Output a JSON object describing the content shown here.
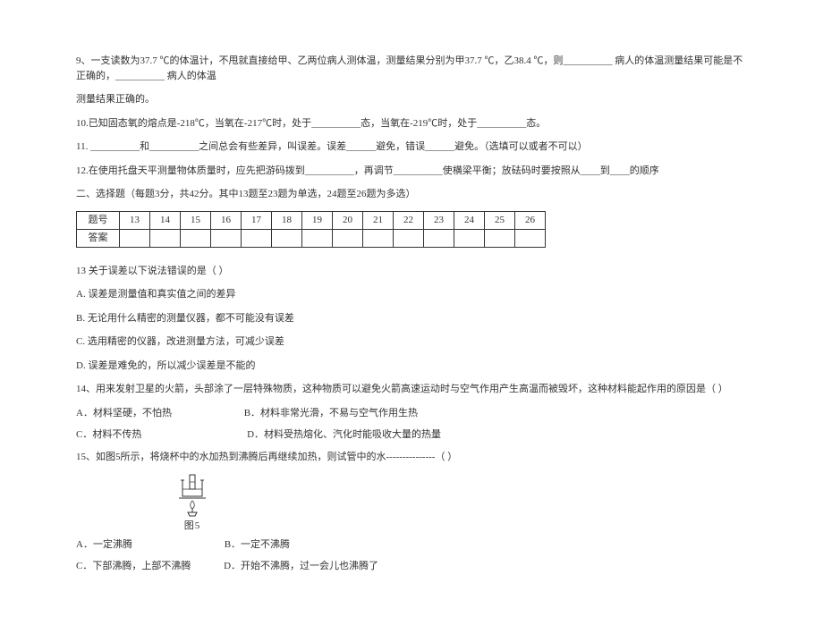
{
  "q9": {
    "text": "9、一支读数为37.7 ℃的体温计，不甩就直接给甲、乙两位病人测体温，测量结果分别为甲37.7 ℃，乙38.4 ℃，则__________ 病人的体温测量结果可能是不正确的，__________ 病人的体温",
    "cont": "测量结果正确的。"
  },
  "q10": "10.已知固态氧的熔点是-218℃，当氧在-217℃时，处于__________态，当氧在-219℃时，处于__________态。",
  "q11": "11. __________和__________之间总会有些差异，叫误差。误差______避免，错误______避免。（选填可以或者不可以）",
  "q12": "12.在使用托盘天平测量物体质量时，应先把游码拨到__________，再调节__________使横梁平衡；放砝码时要按照从____到____的顺序",
  "section2": "二、选择题（每题3分，共42分。其中13题至23题为单选，24题至26题为多选）",
  "table": {
    "row1_label": "题号",
    "cols": [
      "13",
      "14",
      "15",
      "16",
      "17",
      "18",
      "19",
      "20",
      "21",
      "22",
      "23",
      "24",
      "25",
      "26"
    ],
    "row2_label": "答案"
  },
  "q13": {
    "stem": "13 关于误差以下说法错误的是（    ）",
    "a": "A. 误差是测量值和真实值之间的差异",
    "b": "B. 无论用什么精密的测量仪器，都不可能没有误差",
    "c": "C. 选用精密的仪器，改进测量方法，可减少误差",
    "d": "D. 误差是难免的，所以减少误差是不能的"
  },
  "q14": {
    "stem": "14、用来发射卫星的火箭，头部涂了一层特殊物质，这种物质可以避免火箭高速运动时与空气作用产生高温而被毁坏，这种材料能起作用的原因是（    ）",
    "a": "A．材料坚硬，不怕热",
    "b": "B．材料非常光滑，不易与空气作用生热",
    "c": "C．材料不传热",
    "d": "D．材料受热熔化、汽化时能吸收大量的热量"
  },
  "q15": {
    "stem": "15、如图5所示，将烧杯中的水加热到沸腾后再继续加热，则试管中的水---------------（    ）",
    "figlabel": "图5",
    "a": "A．一定沸腾",
    "b": "B．一定不沸腾",
    "c": "C．下部沸腾，上部不沸腾",
    "d": "D．开始不沸腾，过一会儿也沸腾了"
  }
}
